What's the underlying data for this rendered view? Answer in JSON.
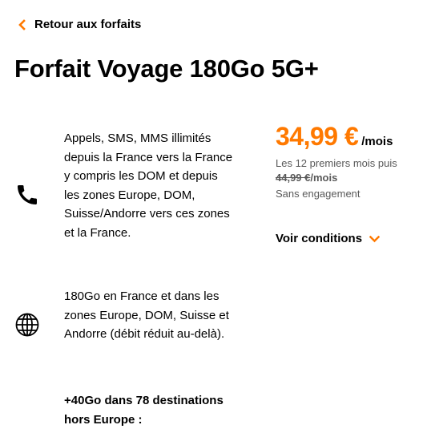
{
  "nav": {
    "back_label": "Retour aux forfaits"
  },
  "title": "Forfait Voyage 180Go 5G+",
  "features": [
    {
      "icon": "phone-icon",
      "text": "Appels, SMS, MMS illimités depuis la France vers la France y compris les DOM et depuis les zones Europe, DOM, Suisse/Andorre vers ces zones et la France."
    },
    {
      "icon": "globe-icon",
      "text": "180Go en France et dans les zones Europe, DOM, Suisse et Andorre (débit réduit au-delà)."
    },
    {
      "icon": "",
      "text": "+40Go  dans 78 destinations hors Europe :"
    }
  ],
  "pricing": {
    "price": "34,99 €",
    "unit": "/mois",
    "promo_text": "Les 12 premiers mois puis",
    "old_price": "44,99 €",
    "old_price_unit": "/mois",
    "commitment": "Sans engagement",
    "conditions_label": "Voir conditions"
  },
  "colors": {
    "accent": "#ff7900",
    "secondary_text": "#595959"
  }
}
